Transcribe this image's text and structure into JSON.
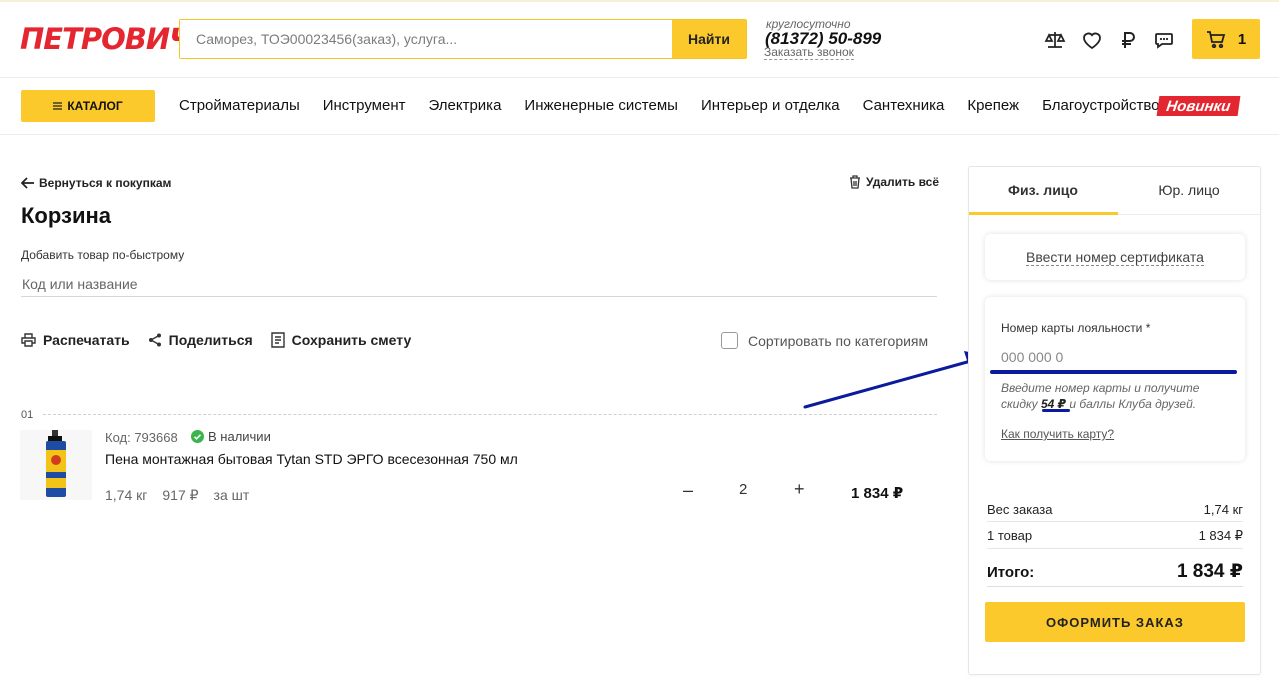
{
  "header": {
    "logo": "ПЕТРОВИЧ",
    "search_placeholder": "Саморез, ТОЭ00023456(заказ), услуга...",
    "search_button": "Найти",
    "phone_note": "круглосуточно",
    "phone": "(81372) 50-899",
    "callback": "Заказать звонок",
    "cart_count": "1",
    "icons": [
      "compare-scale-icon",
      "heart-icon",
      "ruble-icon",
      "chat-icon",
      "cart-icon"
    ]
  },
  "nav": {
    "catalog": "КАТАЛОГ",
    "items": [
      "Стройматериалы",
      "Инструмент",
      "Электрика",
      "Инженерные системы",
      "Интерьер и отделка",
      "Сантехника",
      "Крепеж",
      "Благоустройство"
    ],
    "new_badge": "Новинки"
  },
  "cart": {
    "back": "Вернуться к покупкам",
    "delete_all": "Удалить всё",
    "title": "Корзина",
    "quick_add_label": "Добавить товар по-быстрому",
    "quick_add_placeholder": "Код или название",
    "actions": {
      "print": "Распечатать",
      "share": "Поделиться",
      "save": "Сохранить смету"
    },
    "sort_label": "Сортировать по категориям",
    "group_number": "01",
    "item": {
      "code": "Код: 793668",
      "stock": "В наличии",
      "name": "Пена монтажная бытовая Tytan STD ЭРГО всесезонная 750 мл",
      "weight": "1,74 кг",
      "price": "917 ₽",
      "unit": "за шт",
      "quantity": "2",
      "minus": "–",
      "plus": "+",
      "total": "1 834 ₽"
    }
  },
  "summary": {
    "tabs": [
      "Физ. лицо",
      "Юр. лицо"
    ],
    "certificate_link": "Ввести номер сертификата",
    "loyalty_label": "Номер карты лояльности *",
    "loyalty_placeholder": "000 000 0",
    "loyalty_hint_1": "Введите номер карты и получите скидку",
    "loyalty_discount": "54 ₽",
    "loyalty_hint_2": "и баллы Клуба друзей.",
    "how_to_get": "Как получить карту?",
    "weight_label": "Вес заказа",
    "weight_value": "1,74 кг",
    "items_label": "1 товар",
    "items_value": "1 834 ₽",
    "total_label": "Итого:",
    "total_value": "1 834 ₽",
    "order_button": "ОФОРМИТЬ ЗАКАЗ"
  },
  "colors": {
    "accent": "#fbc92b",
    "brand_red": "#e3262f",
    "annotation_blue": "#0b1b9b"
  }
}
